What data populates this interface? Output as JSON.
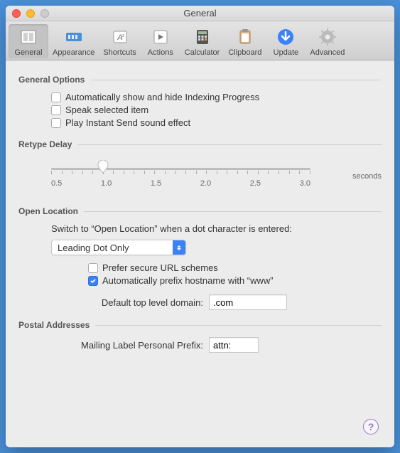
{
  "window": {
    "title": "General"
  },
  "toolbar": {
    "items": [
      {
        "label": "General"
      },
      {
        "label": "Appearance"
      },
      {
        "label": "Shortcuts"
      },
      {
        "label": "Actions"
      },
      {
        "label": "Calculator"
      },
      {
        "label": "Clipboard"
      },
      {
        "label": "Update"
      },
      {
        "label": "Advanced"
      }
    ]
  },
  "generalOptions": {
    "header": "General Options",
    "checks": [
      "Automatically show and hide Indexing Progress",
      "Speak selected item",
      "Play Instant Send sound effect"
    ]
  },
  "retype": {
    "header": "Retype Delay",
    "ticks": [
      "0.5",
      "1.0",
      "1.5",
      "2.0",
      "2.5",
      "3.0"
    ],
    "unit": "seconds",
    "value": 1.0
  },
  "openLocation": {
    "header": "Open Location",
    "desc": "Switch to “Open Location” when a dot character is entered:",
    "selectValue": "Leading Dot Only",
    "preferSecure": "Prefer secure URL schemes",
    "autoPrefix": "Automatically prefix hostname with “www”",
    "tldLabel": "Default top level domain:",
    "tldValue": ".com"
  },
  "postal": {
    "header": "Postal Addresses",
    "prefixLabel": "Mailing Label Personal Prefix:",
    "prefixValue": "attn:"
  },
  "help": "?"
}
